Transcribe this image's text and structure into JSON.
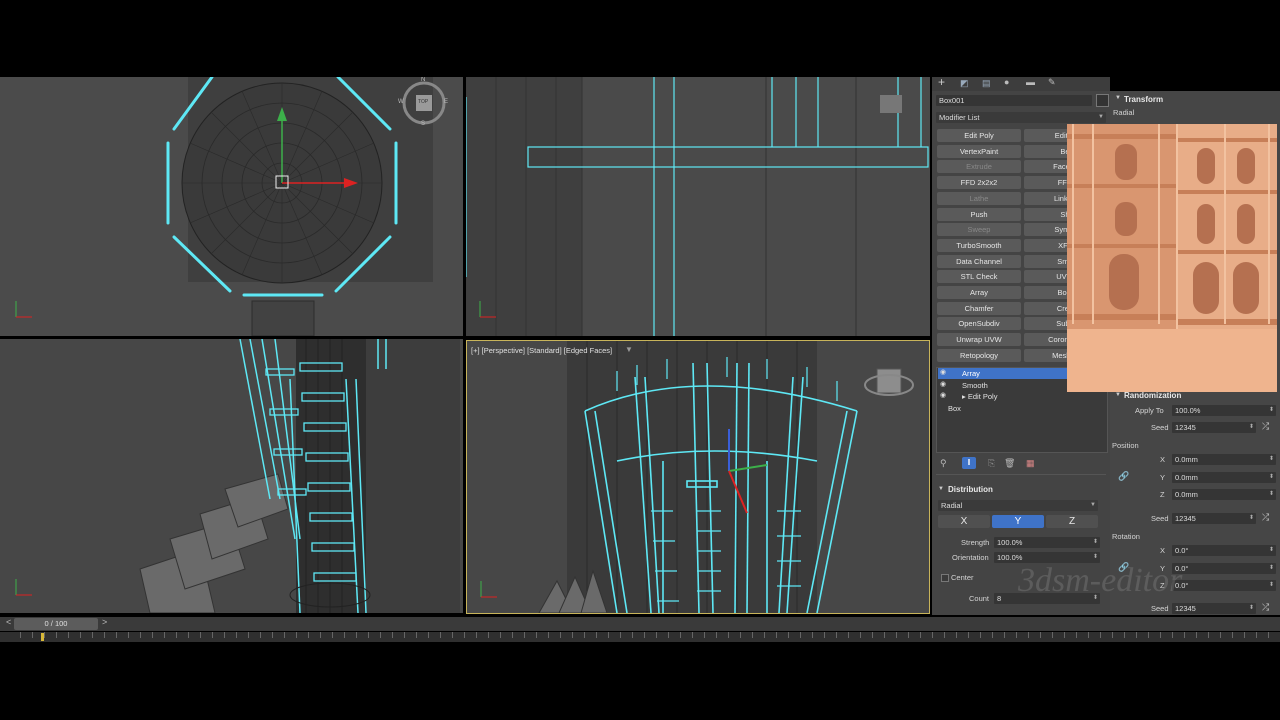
{
  "viewport": {
    "label": "[+] [Perspective] [Standard] [Edged Faces]"
  },
  "viewcube": {
    "top_label": "TOP",
    "n": "N",
    "s": "S",
    "e": "E",
    "w": "W"
  },
  "command_panel": {
    "object_name": "Box001",
    "modifier_list_label": "Modifier List",
    "modifier_buttons_left": [
      "Edit Poly",
      "VertexPaint",
      "Extrude",
      "FFD 2x2x2",
      "Lathe",
      "Push",
      "Sweep",
      "TurboSmooth",
      "Data Channel",
      "STL Check",
      "Array",
      "Chamfer",
      "OpenSubdiv",
      "Unwrap UVW",
      "Retopology"
    ],
    "modifier_buttons_left_disabled": [
      false,
      false,
      true,
      false,
      true,
      false,
      true,
      false,
      false,
      false,
      false,
      false,
      false,
      false,
      false
    ],
    "modifier_buttons_right": [
      "Edit N",
      "Be",
      "Face E",
      "FFD",
      "Linked",
      "Sh",
      "Symm",
      "XFo",
      "Smo",
      "UVW",
      "Bool",
      "Crea",
      "Subd",
      "CoronaPa",
      "Mesh C"
    ],
    "stack": [
      "Array",
      "Smooth",
      "Edit Poly",
      "Box"
    ],
    "stack_selected": 0
  },
  "distribution": {
    "title": "Distribution",
    "mode": "Radial",
    "axes": [
      "X",
      "Y",
      "Z"
    ],
    "active_axis": "Y",
    "strength_label": "Strength",
    "strength": "100.0%",
    "orientation_label": "Orientation",
    "orientation": "100.0%",
    "center_label": "Center",
    "count_label": "Count",
    "count": "8"
  },
  "transform": {
    "title": "Transform",
    "mode": "Radial"
  },
  "randomization": {
    "title": "Randomization",
    "apply_to_label": "Apply To",
    "apply_to": "100.0%",
    "seed_label": "Seed",
    "seed": "12345",
    "position_label": "Position",
    "rotation_label": "Rotation",
    "axis_labels": [
      "X",
      "Y",
      "Z"
    ],
    "position_values": [
      "0.0mm",
      "0.0mm",
      "0.0mm"
    ],
    "rotation_values": [
      "0.0°",
      "0.0°",
      "0.0°"
    ]
  },
  "timeline": {
    "frame": "0 / 100"
  },
  "watermark": "3dsm-editor",
  "colors": {
    "selection": "#5ee8f5",
    "viewport_bg": "#4a4a4a",
    "panel_bg": "#444444",
    "active_blue": "#3f73c8",
    "active_frame": "#c8b45a"
  }
}
